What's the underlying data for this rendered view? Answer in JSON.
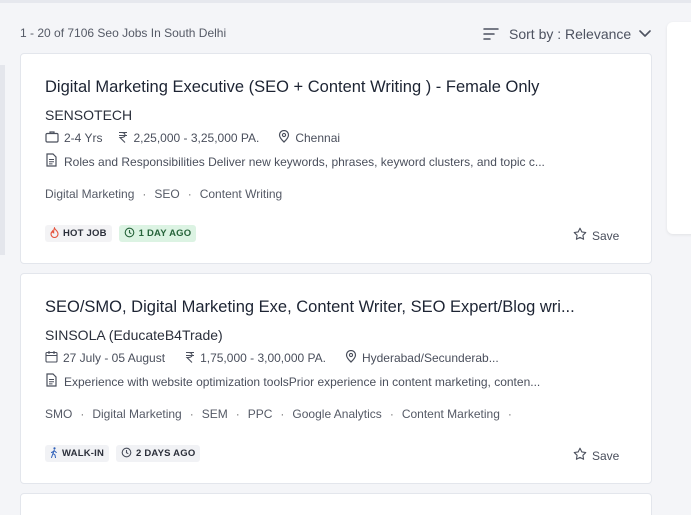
{
  "header": {
    "results_count": "1 - 20 of 7106  Seo Jobs In South Delhi",
    "sort_label": "Sort by : Relevance"
  },
  "jobs": [
    {
      "title": "Digital Marketing Executive (SEO + Content Writing ) - Female Only",
      "company": "SENSOTECH",
      "experience": "2-4 Yrs",
      "salary": "2,25,000 - 3,25,000 PA.",
      "location": "Chennai",
      "description": "Roles and Responsibilities Deliver new keywords, phrases, keyword clusters, and topic c...",
      "tags": [
        "Digital Marketing",
        "SEO",
        "Content Writing"
      ],
      "badges": [
        "HOT JOB",
        "1 DAY AGO"
      ],
      "save_label": "Save"
    },
    {
      "title": "SEO/SMO, Digital Marketing Exe, Content Writer, SEO Expert/Blog wri...",
      "company": "SINSOLA (EducateB4Trade)",
      "date_range": "27 July - 05 August",
      "salary": "1,75,000 - 3,00,000 PA.",
      "location": "Hyderabad/Secunderab...",
      "description": "Experience with website optimization toolsPrior experience in content marketing, conten...",
      "tags": [
        "SMO",
        "Digital Marketing",
        "SEM",
        "PPC",
        "Google Analytics",
        "Content Marketing"
      ],
      "badges": [
        "WALK-IN",
        "2 DAYS AGO"
      ],
      "save_label": "Save"
    }
  ],
  "icons": {
    "sort": "sort-lines-icon",
    "chevron": "chevron-down-icon",
    "experience": "briefcase-icon",
    "salary": "rupee-icon",
    "location": "location-pin-icon",
    "date": "calendar-icon",
    "description": "document-icon",
    "hot": "flame-icon",
    "age": "clock-icon",
    "walkin": "walking-person-icon",
    "save": "star-outline-icon"
  },
  "colors": {
    "hot_icon": "#e5533d",
    "day_badge_bg": "#dcf3e3",
    "day_badge_text": "#27643b"
  }
}
